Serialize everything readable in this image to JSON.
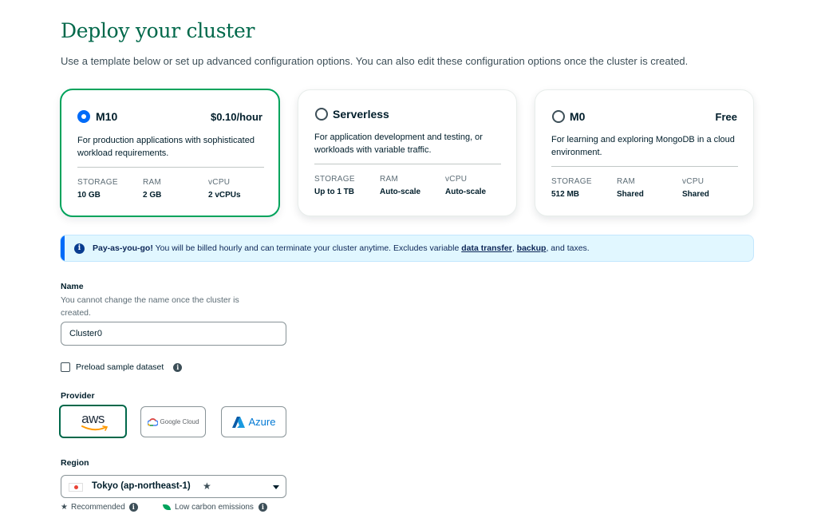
{
  "header": {
    "title": "Deploy your cluster",
    "subtitle": "Use a template below or set up advanced configuration options. You can also edit these configuration options once the cluster is created."
  },
  "tiers": [
    {
      "name": "M10",
      "price": "$0.10/hour",
      "selected": true,
      "description": "For production applications with sophisticated workload requirements.",
      "specs": [
        {
          "label": "STORAGE",
          "value": "10 GB"
        },
        {
          "label": "RAM",
          "value": "2 GB"
        },
        {
          "label": "vCPU",
          "value": "2 vCPUs"
        }
      ]
    },
    {
      "name": "Serverless",
      "price": "",
      "selected": false,
      "description": "For application development and testing, or workloads with variable traffic.",
      "specs": [
        {
          "label": "STORAGE",
          "value": "Up to 1 TB"
        },
        {
          "label": "RAM",
          "value": "Auto-scale"
        },
        {
          "label": "vCPU",
          "value": "Auto-scale"
        }
      ]
    },
    {
      "name": "M0",
      "price": "Free",
      "selected": false,
      "description": "For learning and exploring MongoDB in a cloud environment.",
      "specs": [
        {
          "label": "STORAGE",
          "value": "512 MB"
        },
        {
          "label": "RAM",
          "value": "Shared"
        },
        {
          "label": "vCPU",
          "value": "Shared"
        }
      ]
    }
  ],
  "banner": {
    "lead": "Pay-as-you-go!",
    "text": " You will be billed hourly and can terminate your cluster anytime. Excludes variable ",
    "link1": "data transfer",
    "sep": ", ",
    "link2": "backup",
    "tail": ", and taxes."
  },
  "name_field": {
    "label": "Name",
    "hint": "You cannot change the name once the cluster is created.",
    "value": "Cluster0"
  },
  "preload": {
    "label": "Preload sample dataset",
    "checked": false
  },
  "provider": {
    "label": "Provider",
    "options": [
      {
        "name": "aws",
        "selected": true
      },
      {
        "name": "Google Cloud",
        "selected": false
      },
      {
        "name": "Azure",
        "selected": false
      }
    ]
  },
  "region": {
    "label": "Region",
    "value": "Tokyo (ap-northeast-1)",
    "legend_recommended": "Recommended",
    "legend_low_carbon": "Low carbon emissions"
  },
  "colors": {
    "accent_green": "#00a35c",
    "title_green": "#00684a",
    "selected_radio": "#016bf8",
    "banner_bg": "#e1f7ff"
  }
}
